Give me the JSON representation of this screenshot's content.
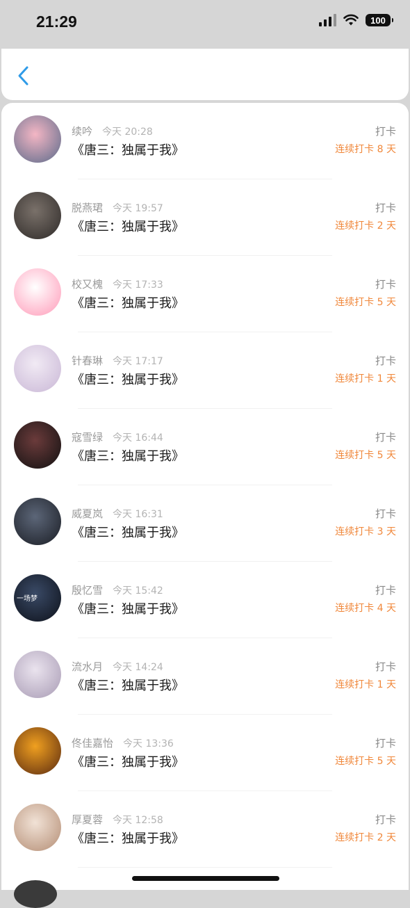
{
  "status_bar": {
    "time": "21:29",
    "battery": "100"
  },
  "nav": {
    "back_icon": "chevron-left-icon",
    "accent": "#2f9be8"
  },
  "colors": {
    "streak": "#f0873a"
  },
  "entries": [
    {
      "name": "续吟",
      "time": "今天 20:28",
      "title": "《唐三：独属于我》",
      "tag": "打卡",
      "streak": "连续打卡 8 天",
      "avatar": [
        "#f4b6c4",
        "#5a6a8a"
      ]
    },
    {
      "name": "脱燕珺",
      "time": "今天 19:57",
      "title": "《唐三：独属于我》",
      "tag": "打卡",
      "streak": "连续打卡 2 天",
      "avatar": [
        "#7a716a",
        "#2e2a28"
      ]
    },
    {
      "name": "校又槐",
      "time": "今天 17:33",
      "title": "《唐三：独属于我》",
      "tag": "打卡",
      "streak": "连续打卡 5 天",
      "avatar": [
        "#ffffff",
        "#ff9ab8"
      ]
    },
    {
      "name": "针春琳",
      "time": "今天 17:17",
      "title": "《唐三：独属于我》",
      "tag": "打卡",
      "streak": "连续打卡 1 天",
      "avatar": [
        "#f1eaf4",
        "#c9b7d6"
      ]
    },
    {
      "name": "寇雪绿",
      "time": "今天 16:44",
      "title": "《唐三：独属于我》",
      "tag": "打卡",
      "streak": "连续打卡 5 天",
      "avatar": [
        "#6b3b3b",
        "#111111"
      ]
    },
    {
      "name": "威夏岚",
      "time": "今天 16:31",
      "title": "《唐三：独属于我》",
      "tag": "打卡",
      "streak": "连续打卡 3 天",
      "avatar": [
        "#5c6678",
        "#1a1d24"
      ]
    },
    {
      "name": "殷忆雪",
      "time": "今天 15:42",
      "title": "《唐三：独属于我》",
      "tag": "打卡",
      "streak": "连续打卡 4 天",
      "avatar": [
        "#3a4a66",
        "#0d111a"
      ],
      "avatar_text": "一场梦"
    },
    {
      "name": "流水月",
      "time": "今天 14:24",
      "title": "《唐三：独属于我》",
      "tag": "打卡",
      "streak": "连续打卡 1 天",
      "avatar": [
        "#eae3ee",
        "#a89bb4"
      ]
    },
    {
      "name": "佟佳嘉怡",
      "time": "今天 13:36",
      "title": "《唐三：独属于我》",
      "tag": "打卡",
      "streak": "连续打卡 5 天",
      "avatar": [
        "#f0a020",
        "#5a2a10"
      ]
    },
    {
      "name": "厚夏蓉",
      "time": "今天 12:58",
      "title": "《唐三：独属于我》",
      "tag": "打卡",
      "streak": "连续打卡 2 天",
      "avatar": [
        "#f1e2d6",
        "#b48d74"
      ]
    }
  ]
}
